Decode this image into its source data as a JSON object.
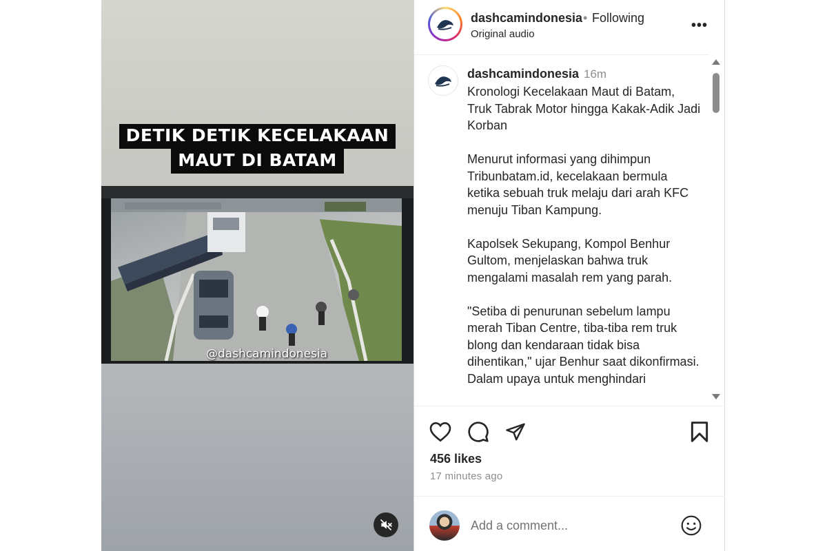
{
  "video": {
    "overlay_title_line1": "DETIK DETIK KECELAKAAN",
    "overlay_title_line2": "MAUT DI BATAM",
    "watermark": "@dashcamindonesia",
    "mute_icon": "speaker-muted-icon"
  },
  "header": {
    "username": "dashcamindonesia",
    "separator": "•",
    "follow_status": "Following",
    "audio": "Original audio",
    "more_icon": "more-options-icon",
    "more_label": "•••"
  },
  "caption": {
    "username": "dashcamindonesia",
    "time": "16m",
    "text": "Kronologi Kecelakaan Maut di Batam, Truk Tabrak Motor hingga Kakak-Adik Jadi Korban\n\nMenurut informasi yang dihimpun Tribunbatam.id, kecelakaan bermula ketika sebuah truk melaju dari arah KFC menuju Tiban Kampung.\n\nKapolsek Sekupang, Kompol Benhur Gultom, menjelaskan bahwa truk mengalami masalah rem yang parah.\n\n\"Setiba di penurunan sebelum lampu merah Tiban Centre, tiba-tiba rem truk blong dan kendaraan tidak bisa dihentikan,\" ujar Benhur saat dikonfirmasi.\nDalam upaya untuk menghindari"
  },
  "actions": {
    "like_icon": "heart-icon",
    "comment_icon": "comment-icon",
    "share_icon": "share-icon",
    "save_icon": "bookmark-icon",
    "likes": "456 likes",
    "posted": "17 minutes ago"
  },
  "comment": {
    "placeholder": "Add a comment...",
    "emoji_icon": "emoji-icon"
  },
  "colors": {
    "text": "#262626",
    "muted": "#8e8e8e",
    "border": "#dbdbdb"
  }
}
